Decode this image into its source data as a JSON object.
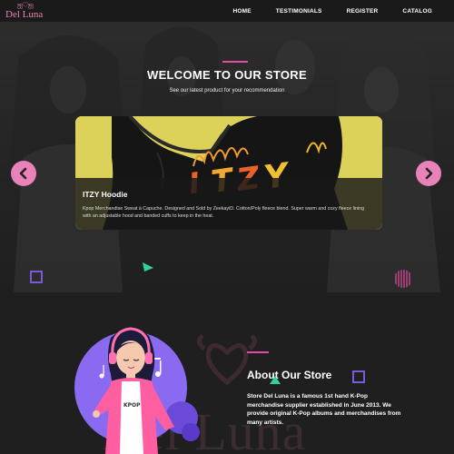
{
  "brand": {
    "logo_text": "Del Luna",
    "logo_ornament": "ஐ♡ஐ"
  },
  "nav": {
    "items": [
      "HOME",
      "TESTIMONIALS",
      "REGISTER",
      "CATALOG"
    ]
  },
  "hero": {
    "title": "WELCOME TO OUR STORE",
    "subtitle": "See our latest product for your recommendation"
  },
  "product": {
    "name": "ITZY Hoodie",
    "description": "Kpop Merchandise Sweat à Capuche. Designed and Sold by ZeekayiD. Cotton/Poly fleece blend. Super warm and cozy fleece lining with an adjustable hood and banded cuffs to keep in the heat.",
    "print_text": "ITZY"
  },
  "about": {
    "title": "About Our Store",
    "text": "Store Del Luna is a famous 1st hand K-Pop merchandise supplier established in June 2013. We provide original K-Pop albums and merchandises from many artists.",
    "watermark": "Del Luna",
    "shirt_text": "KPOP"
  },
  "colors": {
    "accent_pink": "#e882b8",
    "bar_pink": "#e64aa0",
    "purple": "#7a5ad8",
    "teal": "#2fd1a0",
    "card_yellow": "#dcd25a"
  },
  "icons": [
    "chevron-left-icon",
    "chevron-right-icon",
    "music-note-icon"
  ]
}
